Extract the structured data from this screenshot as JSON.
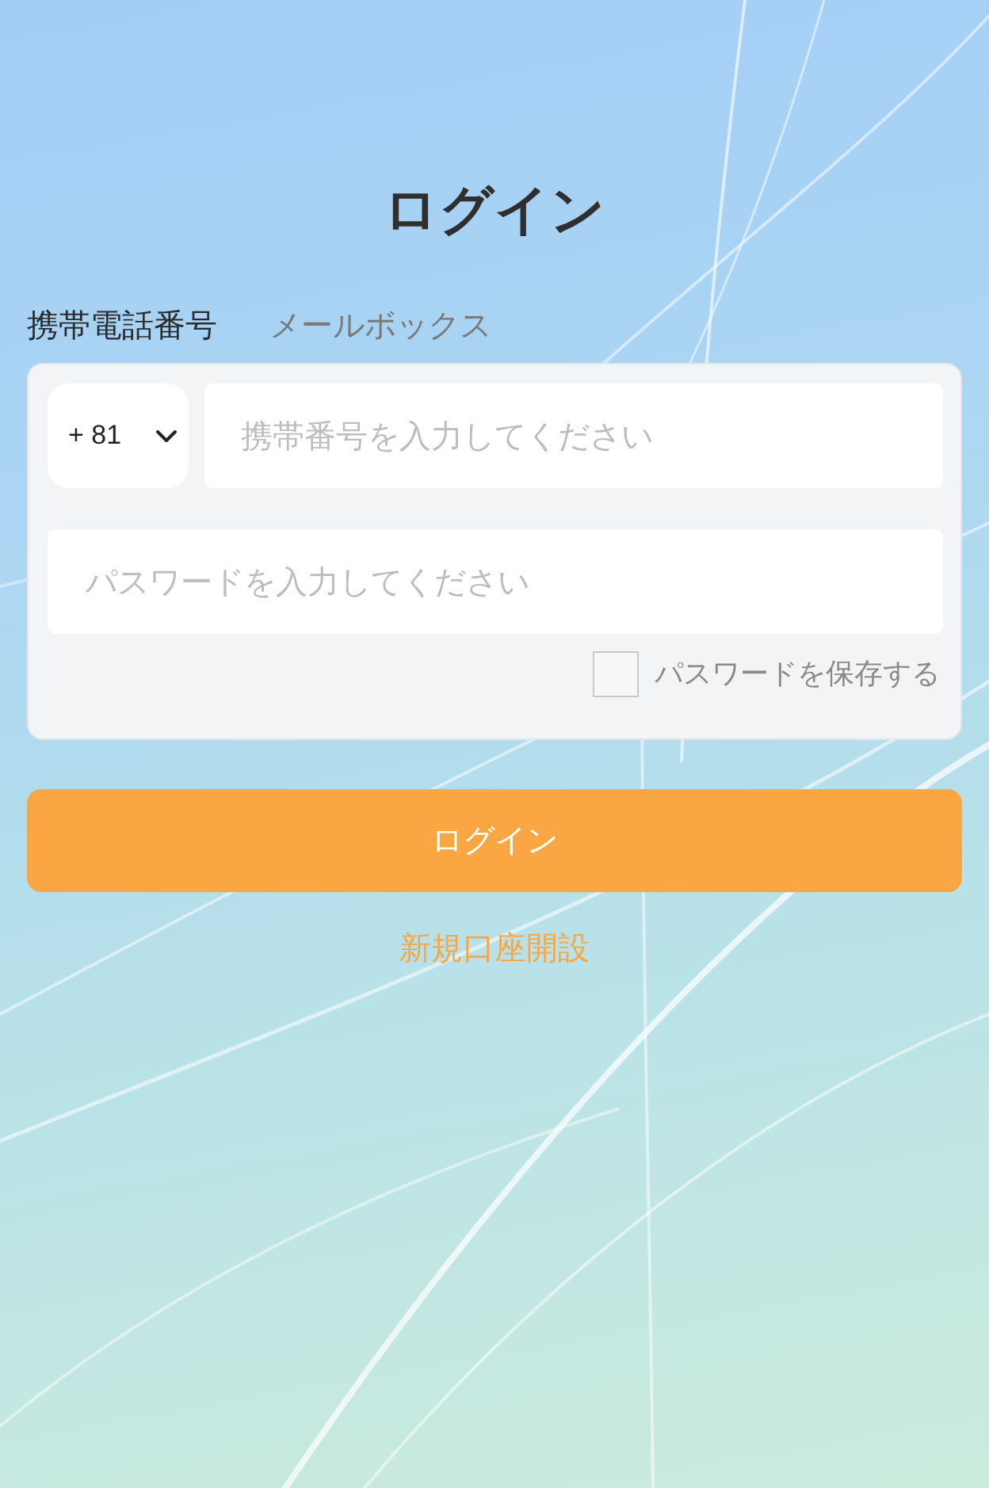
{
  "title": "ログイン",
  "tabs": [
    {
      "label": "携帯電話番号",
      "selected": true
    },
    {
      "label": "メールボックス",
      "selected": false
    }
  ],
  "form": {
    "country_code": "+ 81",
    "phone": {
      "placeholder": "携帯番号を入力してください"
    },
    "password": {
      "placeholder": "パスワードを入力してください"
    },
    "remember": {
      "label": "パスワードを保存する",
      "checked": false
    }
  },
  "login_button": "ログイン",
  "register_link": "新規口座開設"
}
